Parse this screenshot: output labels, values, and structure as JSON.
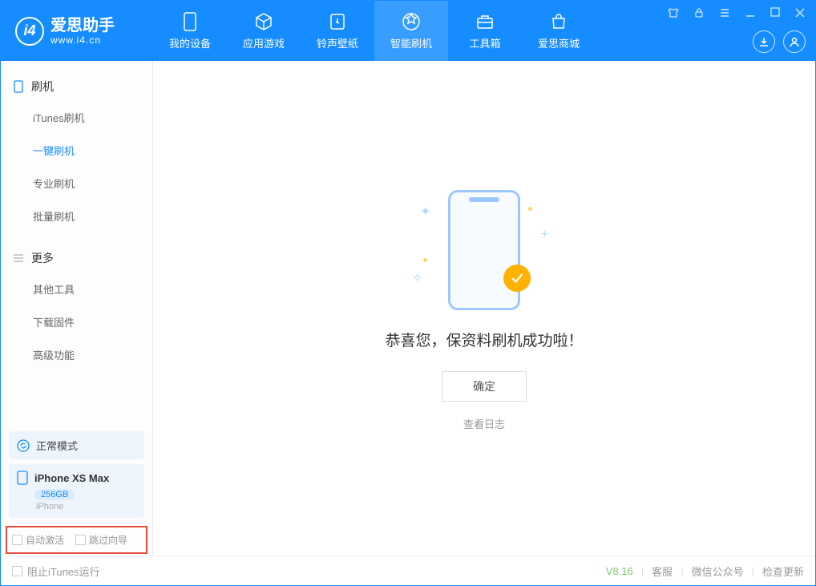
{
  "app": {
    "name": "爱思助手",
    "url": "www.i4.cn"
  },
  "navTabs": {
    "device": "我的设备",
    "apps": "应用游戏",
    "media": "铃声壁纸",
    "flash": "智能刷机",
    "tools": "工具箱",
    "store": "爱思商城"
  },
  "sidebar": {
    "section1": {
      "title": "刷机",
      "items": {
        "itunes": "iTunes刷机",
        "oneclick": "一键刷机",
        "pro": "专业刷机",
        "batch": "批量刷机"
      }
    },
    "section2": {
      "title": "更多",
      "items": {
        "other": "其他工具",
        "firmware": "下载固件",
        "advanced": "高级功能"
      }
    }
  },
  "device": {
    "mode": "正常模式",
    "name": "iPhone XS Max",
    "capacity": "256GB",
    "type": "iPhone"
  },
  "options": {
    "autoActivate": "自动激活",
    "skipGuide": "跳过向导"
  },
  "result": {
    "message": "恭喜您，保资料刷机成功啦！",
    "okButton": "确定",
    "logLink": "查看日志"
  },
  "status": {
    "blockItunes": "阻止iTunes运行",
    "version": "V8.16",
    "support": "客服",
    "wechat": "微信公众号",
    "update": "检查更新"
  }
}
